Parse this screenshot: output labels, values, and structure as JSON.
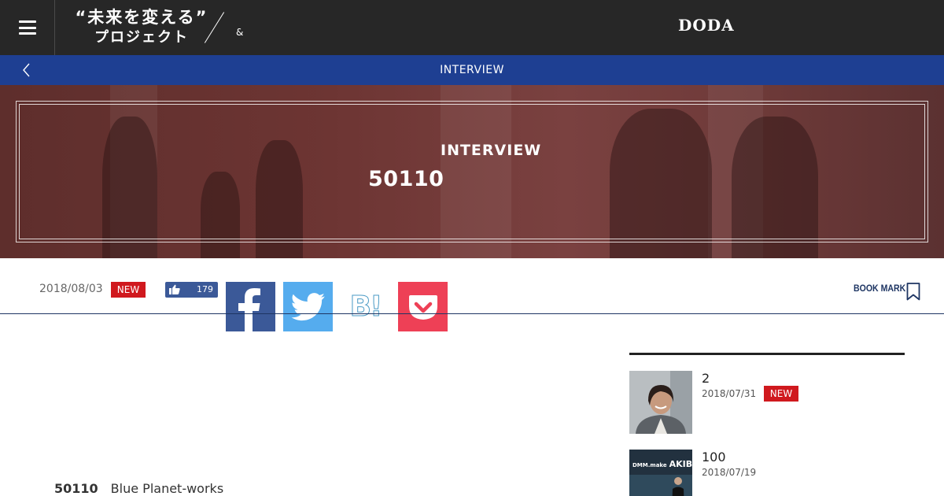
{
  "header": {
    "logo_line1": "“未来を変える”",
    "logo_line2": "プロジェクト",
    "logo_amp": "&",
    "brand": "DODA"
  },
  "navbar": {
    "title": "INTERVIEW"
  },
  "hero": {
    "kicker": "INTERVIEW",
    "title": "50110"
  },
  "meta": {
    "date": "2018/08/03",
    "new_badge": "NEW",
    "like_count": "179",
    "bookmark_label": "BOOK MARK"
  },
  "share": {
    "hatena_text": "B!"
  },
  "article": {
    "number": "50110",
    "company": "Blue Planet-works"
  },
  "sidebar": {
    "items": [
      {
        "title": "2",
        "date": "2018/07/31",
        "badge": "NEW"
      },
      {
        "title": "100",
        "date": "2018/07/19",
        "badge": "",
        "thumb_text_a": "DMM.make",
        "thumb_text_b": "AKIB"
      }
    ]
  },
  "colors": {
    "header_bg": "#272727",
    "nav_blue": "#1e3f92",
    "badge_red": "#d0191e",
    "facebook": "#3b5998",
    "twitter": "#55acee",
    "pocket": "#ee4056",
    "rule_navy": "#1e3563"
  }
}
